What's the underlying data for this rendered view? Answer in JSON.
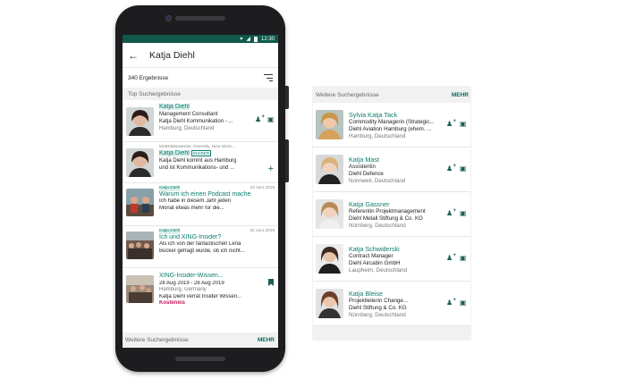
{
  "statusbar": {
    "time": "12:30"
  },
  "app": {
    "title": "Katja Diehl",
    "results_count": "340 Ergebnisse"
  },
  "top_section": {
    "label": "Top Suchergebnisse"
  },
  "top_results": [
    {
      "kind": "person",
      "name": "Katja Diehl",
      "line1": "Management Consultant",
      "line2": "Katja Diehl Kommunikation - ...",
      "line3": "Hamburg, Deutschland",
      "photo": "woman-dark-hair"
    },
    {
      "kind": "person",
      "tagline": "Mobilitätswandel, Diversity, New Work...",
      "name": "Katja Diehl",
      "badge": "INSIDER",
      "line1": "Katja Diehl kommt aus Hamburg",
      "line2": "und ist Kommunikations- und ...",
      "photo": "woman-dark-hair"
    },
    {
      "kind": "article",
      "author": "Katja Diehl",
      "date": "23 Juni 2019",
      "title": "Warum ich einen Podcast mache",
      "line1": "Ich habe in diesem Jahr jeden",
      "line2": "Monat etwas mehr für die...",
      "photo": "group-photo"
    },
    {
      "kind": "article",
      "author": "Katja Diehl",
      "date": "02 Juni 2019",
      "title": "Ich und XING-Insider?",
      "line1": "Als ich von der fantastischen Lena",
      "line2": "Bücker gefragt wurde, ob ich nicht...",
      "photo": "crowd-photo"
    },
    {
      "kind": "event",
      "title": "XING-Insider-Wissen...",
      "dates": "28 Aug 2019 - 28 Aug 2019",
      "place": "Hamburg, Germany",
      "line1": "Katja Diehl verrät Insider Wissen...",
      "price": "Kostenlos",
      "photo": "event-photo"
    }
  ],
  "more_bar": {
    "label": "Weitere Suchergebnisse",
    "action": "MEHR"
  },
  "panel": {
    "label": "Weitere Suchergebnisse",
    "action": "MEHR",
    "people": [
      {
        "name": "Sylvia Katja Tack",
        "title": "Commodity Managerin (Strategic...",
        "company": "Diehl Aviation Hamburg (ehem. ...",
        "location": "Hamburg, Deutschland"
      },
      {
        "name": "Katja Mast",
        "title": "Assistentin",
        "company": "Diehl Defence",
        "location": "Nonnweil, Deutschland"
      },
      {
        "name": "Katja Gassner",
        "title": "Referentin Projektmanagement",
        "company": "Diehl Metall Stiftung & Co. KG",
        "location": "Nürnberg, Deutschland"
      },
      {
        "name": "Katja Schwiderski",
        "title": "Contract Manager",
        "company": "Diehl Aircabin GmbH",
        "location": "Laupheim, Deutschland"
      },
      {
        "name": "Katja Bleise",
        "title": "Projektleiterin Change...",
        "company": "Diehl Stiftung & Co. KG",
        "location": "Nürnberg, Deutschland"
      }
    ]
  },
  "colors": {
    "accent": "#0b7b6e",
    "statusbar": "#0f594a",
    "highlight": "#dcefec",
    "price": "#c2185b"
  }
}
